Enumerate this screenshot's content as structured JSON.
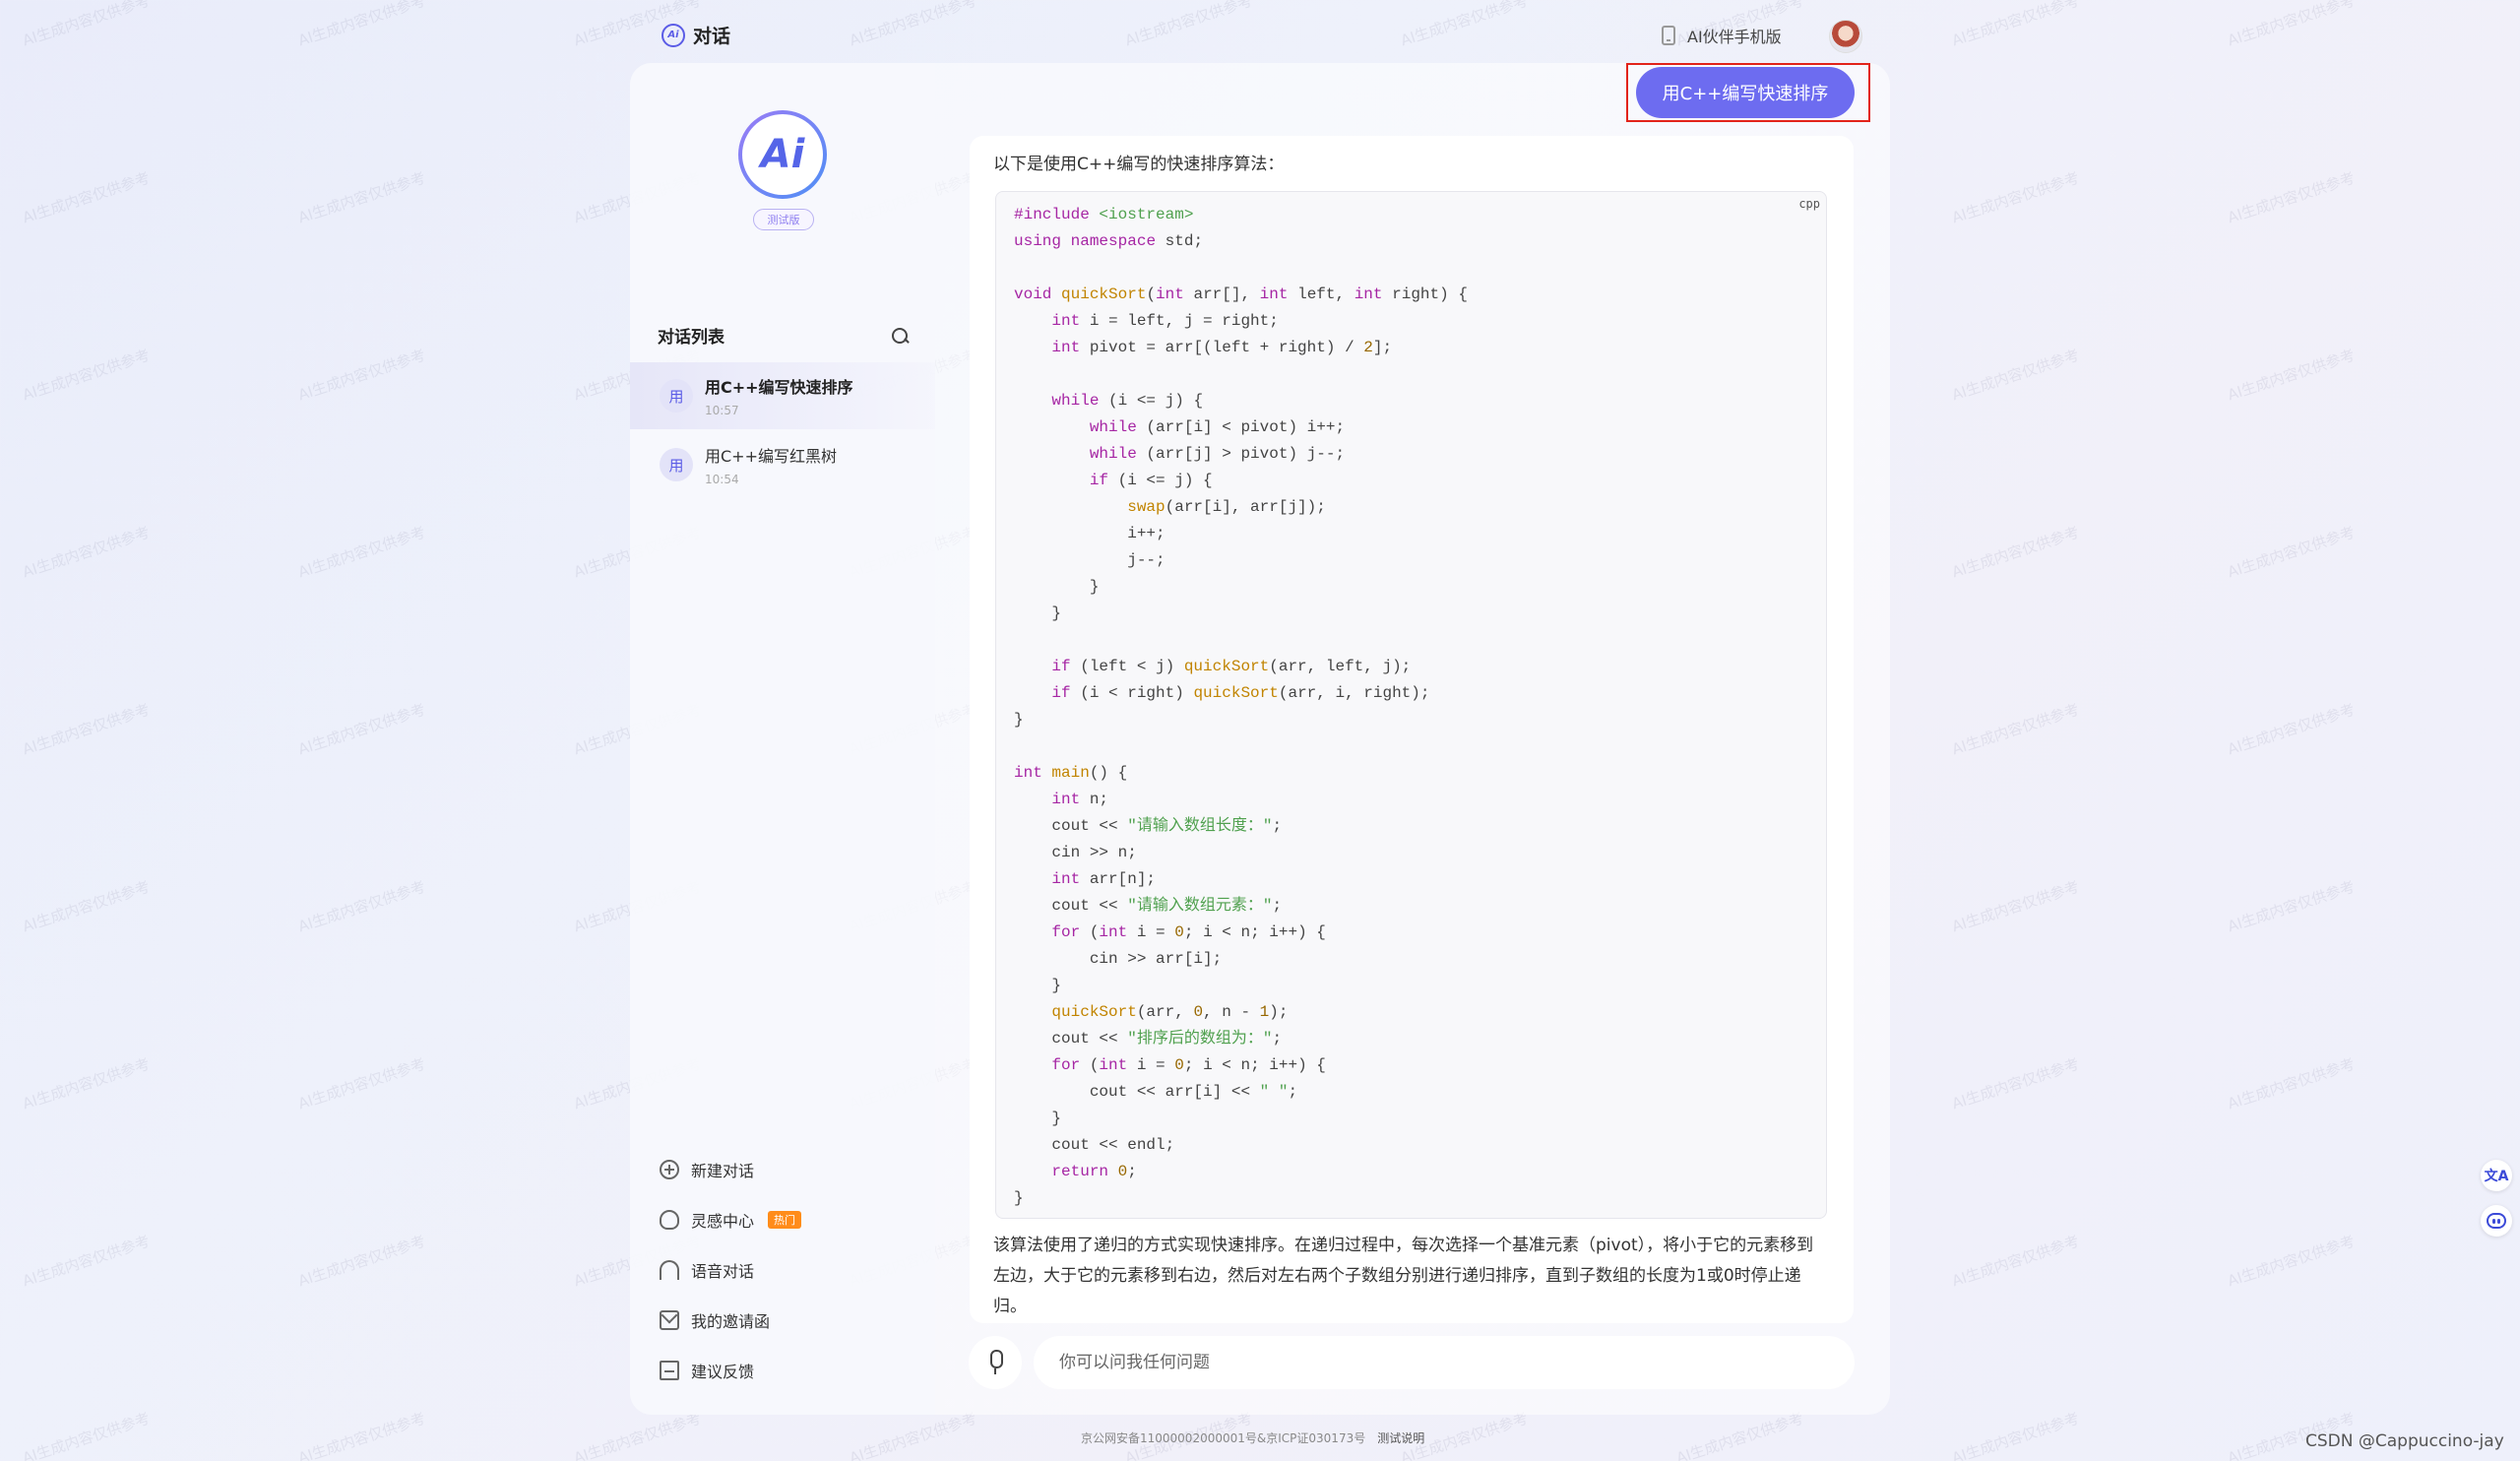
{
  "topbar": {
    "brand_title": "对话",
    "partner_label": "AI伙伴手机版"
  },
  "sidebar": {
    "beta_label": "测试版",
    "conversation_list_title": "对话列表",
    "conversations": [
      {
        "avatar": "用",
        "title": "用C++编写快速排序",
        "time": "10:57",
        "active": true
      },
      {
        "avatar": "用",
        "title": "用C++编写红黑树",
        "time": "10:54",
        "active": false
      }
    ],
    "menu": [
      {
        "label": "新建对话",
        "icon": "plus-circle-icon"
      },
      {
        "label": "灵感中心",
        "icon": "lightbulb-icon",
        "badge": "热门"
      },
      {
        "label": "语音对话",
        "icon": "headphones-icon"
      },
      {
        "label": "我的邀请函",
        "icon": "mail-icon"
      },
      {
        "label": "建议反馈",
        "icon": "edit-icon"
      }
    ]
  },
  "chat": {
    "user_message": "用C++编写快速排序",
    "answer_intro": "以下是使用C++编写的快速排序算法：",
    "code_language": "cpp",
    "code_lines": [
      "#include <iostream>",
      "using namespace std;",
      "",
      "void quickSort(int arr[], int left, int right) {",
      "    int i = left, j = right;",
      "    int pivot = arr[(left + right) / 2];",
      "",
      "    while (i <= j) {",
      "        while (arr[i] < pivot) i++;",
      "        while (arr[j] > pivot) j--;",
      "        if (i <= j) {",
      "            swap(arr[i], arr[j]);",
      "            i++;",
      "            j--;",
      "        }",
      "    }",
      "",
      "    if (left < j) quickSort(arr, left, j);",
      "    if (i < right) quickSort(arr, i, right);",
      "}",
      "",
      "int main() {",
      "    int n;",
      "    cout << \"请输入数组长度：\";",
      "    cin >> n;",
      "    int arr[n];",
      "    cout << \"请输入数组元素：\";",
      "    for (int i = 0; i < n; i++) {",
      "        cin >> arr[i];",
      "    }",
      "    quickSort(arr, 0, n - 1);",
      "    cout << \"排序后的数组为：\";",
      "    for (int i = 0; i < n; i++) {",
      "        cout << arr[i] << \" \";",
      "    }",
      "    cout << endl;",
      "    return 0;",
      "}"
    ],
    "answer_explanation": "该算法使用了递归的方式实现快速排序。在递归过程中，每次选择一个基准元素（pivot），将小于它的元素移到左边，大于它的元素移到右边，然后对左右两个子数组分别进行递归排序，直到子数组的长度为1或0时停止递归。",
    "input_placeholder": "你可以问我任何问题"
  },
  "footer": {
    "icp_text": "京公网安备11000002000001号&京ICP证030173号",
    "test_note": "测试说明"
  },
  "csdn_credit": "CSDN @Cappuccino-jay",
  "side_tools": [
    {
      "icon": "translate-icon",
      "glyph": "文A"
    },
    {
      "icon": "robot-icon",
      "glyph": ""
    }
  ],
  "watermark_text": "AI生成内容仅供参考",
  "colors": {
    "accent": "#6d6cf0",
    "highlight_border": "#e2231a",
    "hot_badge": "#ff8c1a"
  }
}
